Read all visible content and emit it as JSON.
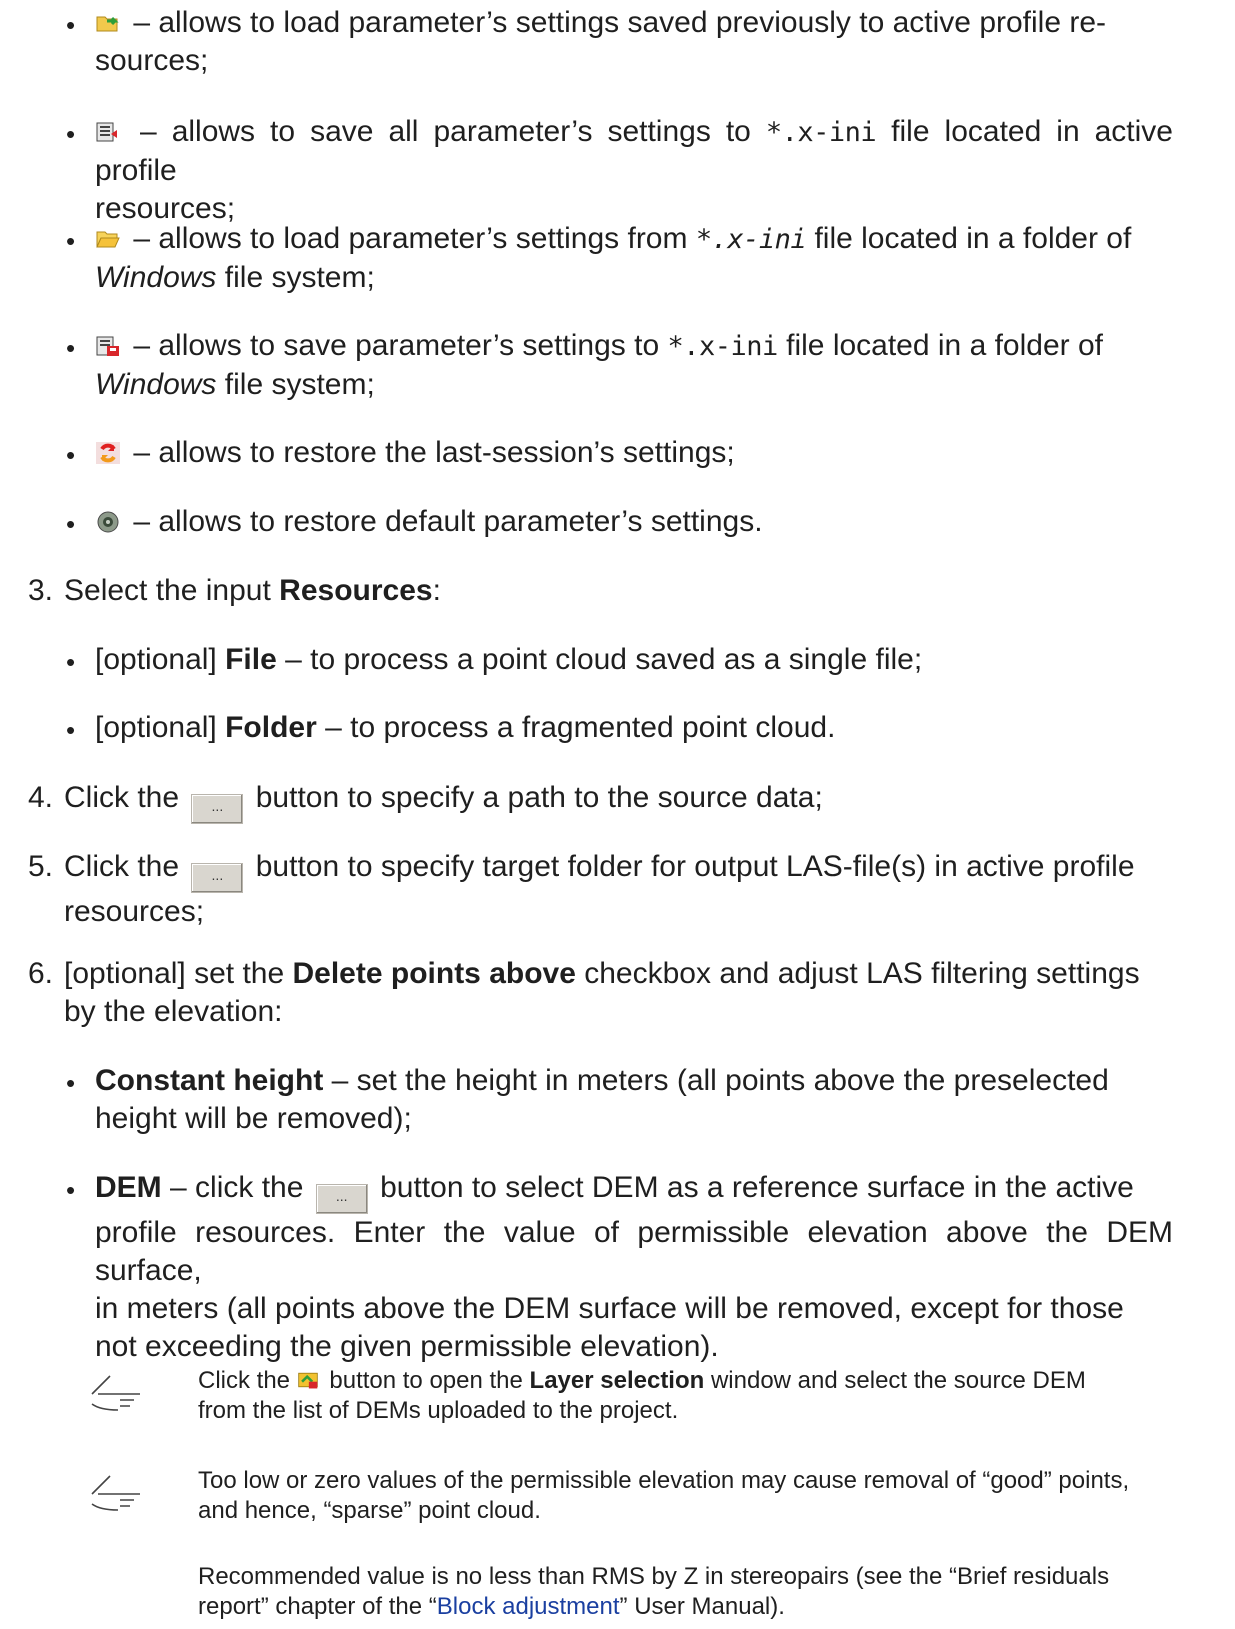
{
  "buttons_list": [
    {
      "icon": "load-previous-settings-icon",
      "text_a": " – allows to load parameter’s settings saved previously to active profile re-",
      "text_b": "sources;"
    },
    {
      "icon": "save-all-settings-icon",
      "text_a": " – allows to save all parameter’s settings to ",
      "code": "*.x-ini",
      "text_c": " file located in active profile",
      "text_b": "resources;"
    },
    {
      "icon": "open-folder-icon",
      "text_a": " – allows to load parameter’s settings from ",
      "code": "*.x-ini",
      "text_c": " file located in a folder of",
      "italic_b": "Windows",
      "text_b": " file system;"
    },
    {
      "icon": "save-to-file-icon",
      "text_a": " – allows to save parameter’s settings to ",
      "code": "*.x-ini",
      "text_c": " file located in a folder of",
      "italic_b": "Windows",
      "text_b": " file system;"
    },
    {
      "icon": "restore-last-session-icon",
      "text_a": " – allows to restore the last-session’s settings;"
    },
    {
      "icon": "restore-defaults-icon",
      "text_a": " – allows to restore default parameter’s settings."
    }
  ],
  "steps": {
    "s3": {
      "num": "3.",
      "pre": "Select the input ",
      "bold": "Resources",
      "post": ":"
    },
    "s3_items": [
      {
        "pre": "[optional] ",
        "bold": "File",
        "post": " – to process a point cloud saved as a single file;"
      },
      {
        "pre": "[optional] ",
        "bold": "Folder",
        "post": " – to process a fragmented point cloud."
      }
    ],
    "s4": {
      "num": "4.",
      "pre": "Click the",
      "btn": "...",
      "post": "button to specify a path to the source data;"
    },
    "s5": {
      "num": "5.",
      "pre": "Click the",
      "btn": "...",
      "post": "button to specify target folder for output LAS-file(s) in active profile",
      "line2": "resources;"
    },
    "s6": {
      "num": "6.",
      "pre": "[optional] set the ",
      "bold": "Delete points above",
      "post": " checkbox and adjust LAS filtering settings",
      "line2": "by the elevation:"
    },
    "s6_item1": {
      "bold": "Constant height",
      "post": " – set the height in meters (all points above the preselected",
      "line2": "height will be removed);"
    },
    "s6_item2": {
      "bold": "DEM",
      "pre2": " – click the",
      "btn": "...",
      "post": "button to select DEM as a reference surface in the active",
      "line2": "profile resources. Enter the value of permissible elevation above the DEM surface,",
      "line3": "in meters (all points above the DEM surface will be removed, except for those",
      "line4": "not exceeding the given permissible elevation)."
    }
  },
  "notes": {
    "n1": {
      "pre": "Click the ",
      "post1": " button to open the ",
      "bold": "Layer selection",
      "post2": " window and select the source DEM",
      "line2": "from the list of DEMs uploaded to the project."
    },
    "n2": {
      "line1": "Too low or zero values of the permissible elevation may cause removal of “good” points,",
      "line2": "and hence, “sparse” point cloud."
    },
    "n3": {
      "line1": "Recommended value is no less than RMS by Z in stereopairs (see the “Brief residuals",
      "line2a": "report” chapter of the “",
      "link": "Block adjustment",
      "line2b": "” User Manual)."
    }
  }
}
